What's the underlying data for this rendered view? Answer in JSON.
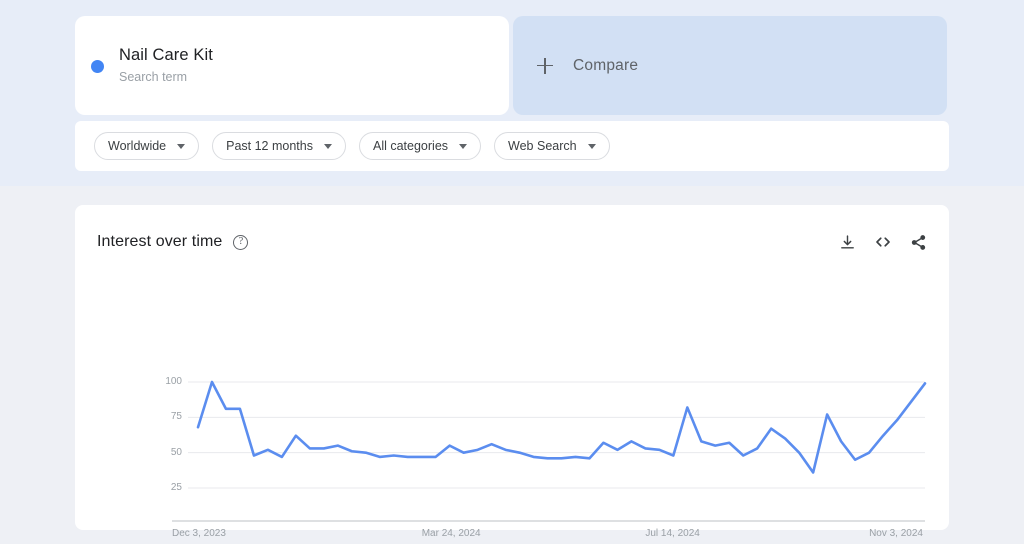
{
  "page": {
    "bg_top": "#e7edf8",
    "bg_bottom": "#eef0f5",
    "accent": "#4285f4"
  },
  "term": {
    "title": "Nail Care Kit",
    "subtitle": "Search term",
    "dot_color": "#4285f4"
  },
  "compare": {
    "label": "Compare",
    "icon": "plus-icon",
    "bg": "#d2e0f4"
  },
  "filters": [
    {
      "label": "Worldwide",
      "icon": "chevron-down-icon"
    },
    {
      "label": "Past 12 months",
      "icon": "chevron-down-icon"
    },
    {
      "label": "All categories",
      "icon": "chevron-down-icon"
    },
    {
      "label": "Web Search",
      "icon": "chevron-down-icon"
    }
  ],
  "chart_card": {
    "title": "Interest over time",
    "help_icon": "help-circle-icon",
    "help_glyph": "?",
    "actions": [
      {
        "name": "download-icon"
      },
      {
        "name": "embed-code-icon"
      },
      {
        "name": "share-icon"
      }
    ]
  },
  "chart_data": {
    "type": "line",
    "title": "Interest over time",
    "xlabel": "",
    "ylabel": "",
    "ylim": [
      0,
      105
    ],
    "grid": true,
    "legend": "Nail Care Kit",
    "line_color": "#5b8def",
    "yticks": [
      100,
      75,
      50,
      25
    ],
    "xtick_labels": [
      "Dec 3, 2023",
      "Mar 24, 2024",
      "Jul 14, 2024",
      "Nov 3, 2024"
    ],
    "xtick_indices": [
      0,
      16,
      32,
      48
    ],
    "series": [
      {
        "name": "Nail Care Kit",
        "values": [
          68,
          100,
          81,
          81,
          48,
          52,
          47,
          62,
          53,
          53,
          55,
          51,
          50,
          47,
          48,
          47,
          47,
          47,
          55,
          50,
          52,
          56,
          52,
          50,
          47,
          46,
          46,
          47,
          46,
          57,
          52,
          58,
          53,
          52,
          48,
          82,
          58,
          55,
          57,
          48,
          53,
          67,
          60,
          50,
          36,
          77,
          58,
          45,
          50,
          62,
          73,
          86,
          99
        ]
      }
    ]
  }
}
